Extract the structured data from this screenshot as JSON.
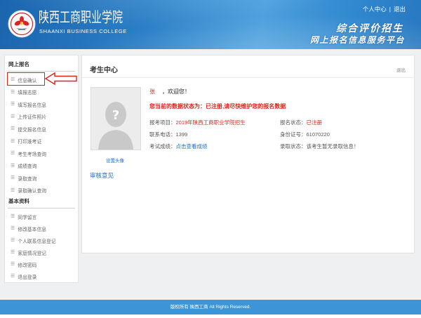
{
  "header": {
    "college_name_cn": "陕西工商职业学院",
    "college_name_en": "SHAANXI BUSINESS COLLEGE",
    "slogan_line1": "综合评价招生",
    "slogan_line2": "网上报名信息服务平台",
    "user_center": "个人中心",
    "separator": "|",
    "logout": "退出",
    "logo_icon": "college-emblem-icon"
  },
  "sidebar": {
    "item_icon": "list-icon",
    "sections": [
      {
        "title": "网上报名",
        "items": [
          "信息确认",
          "填报志愿",
          "填写报名信息",
          "上传证件照片",
          "提交报名信息",
          "打印准考证",
          "考生考场查询",
          "成绩查询",
          "录取查询",
          "录取确认查询"
        ]
      },
      {
        "title": "基本资料",
        "items": [
          "同学留言",
          "修改基本信息",
          "个人联系信息登记",
          "家庭情况登记",
          "修改密码",
          "退出登录"
        ]
      }
    ]
  },
  "main": {
    "title": "考生中心",
    "logout_link": "退出",
    "avatar_icon": "avatar-placeholder-icon",
    "set_avatar": "设置头像",
    "review_opinion": "审核意见",
    "welcome_name": "张",
    "welcome_text": "，欢迎您！",
    "status_notice": "您当前的数据状态为：已注册,请尽快维护您的报名数据",
    "fields": [
      {
        "label": "报考项目：",
        "value": "2019年陕西工商职业学院招生"
      },
      {
        "label": "报名状态：",
        "value": "已注册"
      },
      {
        "label": "联系电话：",
        "value": "1399"
      },
      {
        "label": "身份证号：",
        "value": "61070220"
      },
      {
        "label": "考试成绩：",
        "value": "点击查看成绩"
      },
      {
        "label": "录取状态：",
        "value": "该考生暂无录取信息！"
      }
    ]
  },
  "footer": {
    "copyright": "版权所有 陕西工商 All Rights Reserved."
  },
  "colors": {
    "header_blue": "#2a7fc7",
    "accent_red": "#d9261c",
    "link_blue": "#1a6cc4",
    "footer_blue": "#3b95d6",
    "annotation_red": "#e0201b"
  }
}
